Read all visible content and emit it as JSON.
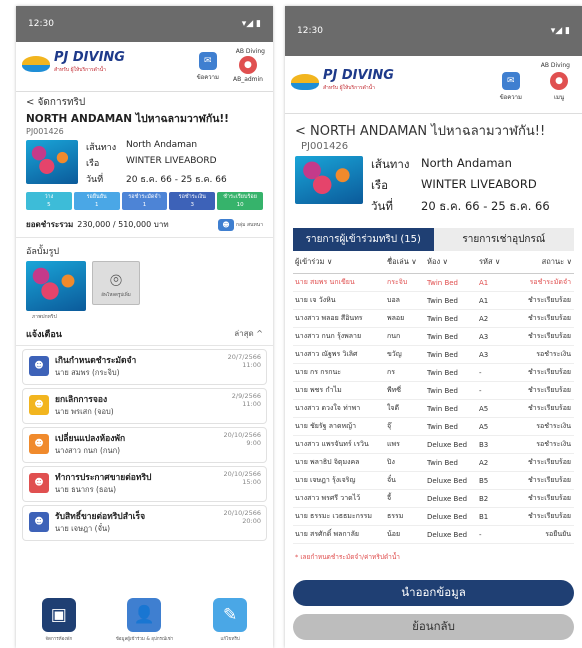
{
  "left": {
    "status_time": "12:30",
    "status_icons": "▾◢ ▮",
    "brand": {
      "name": "PJ DIVING",
      "tagline": "สำหรับ ผู้ให้บริการดำน้ำ"
    },
    "header": {
      "company": "AB Diving",
      "chat_label": "ข้อความ",
      "admin_label": "AB_admin"
    },
    "back_label": "< จัดการทริป",
    "trip": {
      "title": "NORTH ANDAMAN ไปหาฉลามวาฬกัน!!",
      "code": "PJ001426",
      "route_label": "เส้นทาง",
      "route": "North Andaman",
      "boat_label": "เรือ",
      "boat": "WINTER LIVEABORD",
      "date_label": "วันที่",
      "date": "20 ธ.ค. 66 - 25 ธ.ค. 66"
    },
    "stats": [
      {
        "label": "ว่าง",
        "value": "5",
        "color": "#3dbcd8"
      },
      {
        "label": "รอยืนยัน",
        "value": "1",
        "color": "#4aa7e6"
      },
      {
        "label": "รอชำระมัดจำ",
        "value": "1",
        "color": "#4d84d6"
      },
      {
        "label": "รอชำระเงิน",
        "value": "3",
        "color": "#3d62b8"
      },
      {
        "label": "ชำระเรียบร้อย",
        "value": "10",
        "color": "#36b36b"
      }
    ],
    "payment": {
      "label": "ยอดชำระรวม",
      "value": "230,000 / 510,000 บาท",
      "group_label": "กลุ่ม สนทนา"
    },
    "album": {
      "title": "อัลบั้มรูป",
      "add_label": "อัพโหลดรูปเพิ่ม",
      "caption": "ภาพปกทริป"
    },
    "notifications": {
      "title": "แจ้งเตือน",
      "sort": "ล่าสุด ^",
      "items": [
        {
          "title": "เกินกำหนดชำระมัดจำ",
          "sub": "นาย สมพร (กระจิบ)",
          "date": "20/7/2566",
          "time": "11:00",
          "color": "#3d62b8"
        },
        {
          "title": "ยกเลิกการจอง",
          "sub": "นาย พรเสก (จอบ)",
          "date": "2/9/2566",
          "time": "11:00",
          "color": "#f2b51f"
        },
        {
          "title": "เปลี่ยนแปลงห้องพัก",
          "sub": "นางสาว กนก (กนก)",
          "date": "20/10/2566",
          "time": "9:00",
          "color": "#f08a2c"
        },
        {
          "title": "ทำการประกาศขายต่อทริป",
          "sub": "นาย ธนากร (ธอน)",
          "date": "20/10/2566",
          "time": "15:00",
          "color": "#e05050"
        },
        {
          "title": "รับสิทธิ์ขายต่อทริปสำเร็จ",
          "sub": "นาย เจษฎา (จั๋น)",
          "date": "20/10/2566",
          "time": "20:00",
          "color": "#3d62b8"
        }
      ]
    },
    "bottom_nav": [
      {
        "label": "จัดการห้องพัก",
        "icon": "calendar-icon",
        "glyph": "▣",
        "color": "#1f3f73"
      },
      {
        "label": "ข้อมูลผู้เข้าร่วม & อุปกรณ์เช่า",
        "icon": "user-icon",
        "glyph": "👤",
        "color": "#3f7fd0"
      },
      {
        "label": "แก้ไขทริป",
        "icon": "pencil-icon",
        "glyph": "✎",
        "color": "#4aa7e6"
      }
    ]
  },
  "right": {
    "status_time": "12:30",
    "status_icons": "▾◢ ▮",
    "brand": {
      "name": "PJ DIVING",
      "tagline": "สำหรับ ผู้ให้บริการดำน้ำ"
    },
    "header": {
      "company": "AB Diving",
      "chat_label": "ข้อความ",
      "admin_label": "เมนู"
    },
    "back_label": "< NORTH ANDAMAN ไปหาฉลามวาฬกัน!!",
    "trip": {
      "code": "PJ001426",
      "route_label": "เส้นทาง",
      "route": "North Andaman",
      "boat_label": "เรือ",
      "boat": "WINTER LIVEABORD",
      "date_label": "วันที่",
      "date": "20 ธ.ค. 66 - 25 ธ.ค. 66"
    },
    "tabs": [
      "รายการผู้เข้าร่วมทริป (15)",
      "รายการเช่าอุปกรณ์"
    ],
    "table": {
      "headers": [
        "ผู้เข้าร่วม ∨",
        "ชื่อเล่น ∨",
        "ห้อง ∨",
        "รหัส ∨",
        "สถานะ ∨"
      ],
      "rows": [
        {
          "name": "นาย สมพร นกเขียน",
          "nick": "กระจิบ",
          "room": "Twin Bed",
          "code": "A1",
          "status": "รอชำระมัดจำ",
          "highlight": true
        },
        {
          "name": "นาย เจ วังหิน",
          "nick": "บอล",
          "room": "Twin Bed",
          "code": "A1",
          "status": "ชำระเรียบร้อย"
        },
        {
          "name": "นางสาว พลอย สีอินทร",
          "nick": "พลอย",
          "room": "Twin Bed",
          "code": "A2",
          "status": "ชำระเรียบร้อย"
        },
        {
          "name": "นางสาว กนก รุ้งพลาย",
          "nick": "กนก",
          "room": "Twin Bed",
          "code": "A3",
          "status": "ชำระเรียบร้อย"
        },
        {
          "name": "นางสาว ณัฐพร วิเลิศ",
          "nick": "ขวัญ",
          "room": "Twin Bed",
          "code": "A3",
          "status": "รอชำระเงิน"
        },
        {
          "name": "นาย กร กรกนะ",
          "nick": "กร",
          "room": "Twin Bed",
          "code": "-",
          "status": "ชำระเรียบร้อย"
        },
        {
          "name": "นาย พชร กำไม",
          "nick": "พีทซี่",
          "room": "Twin Bed",
          "code": "-",
          "status": "ชำระเรียบร้อย"
        },
        {
          "name": "นางสาว ดวงใจ ท่าพา",
          "nick": "ใจดี",
          "room": "Twin Bed",
          "code": "A5",
          "status": "ชำระเรียบร้อย"
        },
        {
          "name": "นาย ชัยรัฐ ลาดหญ้า",
          "nick": "จุ๊",
          "room": "Twin Bed",
          "code": "A5",
          "status": "รอชำระเงิน"
        },
        {
          "name": "นางสาว แพรจันทร์ เรวิน",
          "nick": "แพร",
          "room": "Deluxe Bed",
          "code": "B3",
          "status": "รอชำระเงิน"
        },
        {
          "name": "นาย พลาธิป จิตุมงคล",
          "nick": "ปิง",
          "room": "Twin Bed",
          "code": "A2",
          "status": "ชำระเรียบร้อย"
        },
        {
          "name": "นาย เจษฎา รุ้งเจริญ",
          "nick": "จั๋น",
          "room": "Deluxe Bed",
          "code": "B5",
          "status": "ชำระเรียบร้อย"
        },
        {
          "name": "นางสาว พรศรี วาดไว้",
          "nick": "จี้",
          "room": "Deluxe Bed",
          "code": "B2",
          "status": "ชำระเรียบร้อย"
        },
        {
          "name": "นาย ธรรมะ เวธธมะกรรม",
          "nick": "ธรรม",
          "room": "Deluxe Bed",
          "code": "B1",
          "status": "ชำระเรียบร้อย"
        },
        {
          "name": "นาย สรศักดิ์ พลกาลัย",
          "nick": "น้อย",
          "room": "Deluxe Bed",
          "code": "-",
          "status": "รอยืนยัน"
        }
      ]
    },
    "note": "* เลยกำหนดชำระมัดจำ/ค่าทริปดำน้ำ",
    "export_button": "นำออกข้อมูล",
    "back_button": "ย้อนกลับ"
  }
}
